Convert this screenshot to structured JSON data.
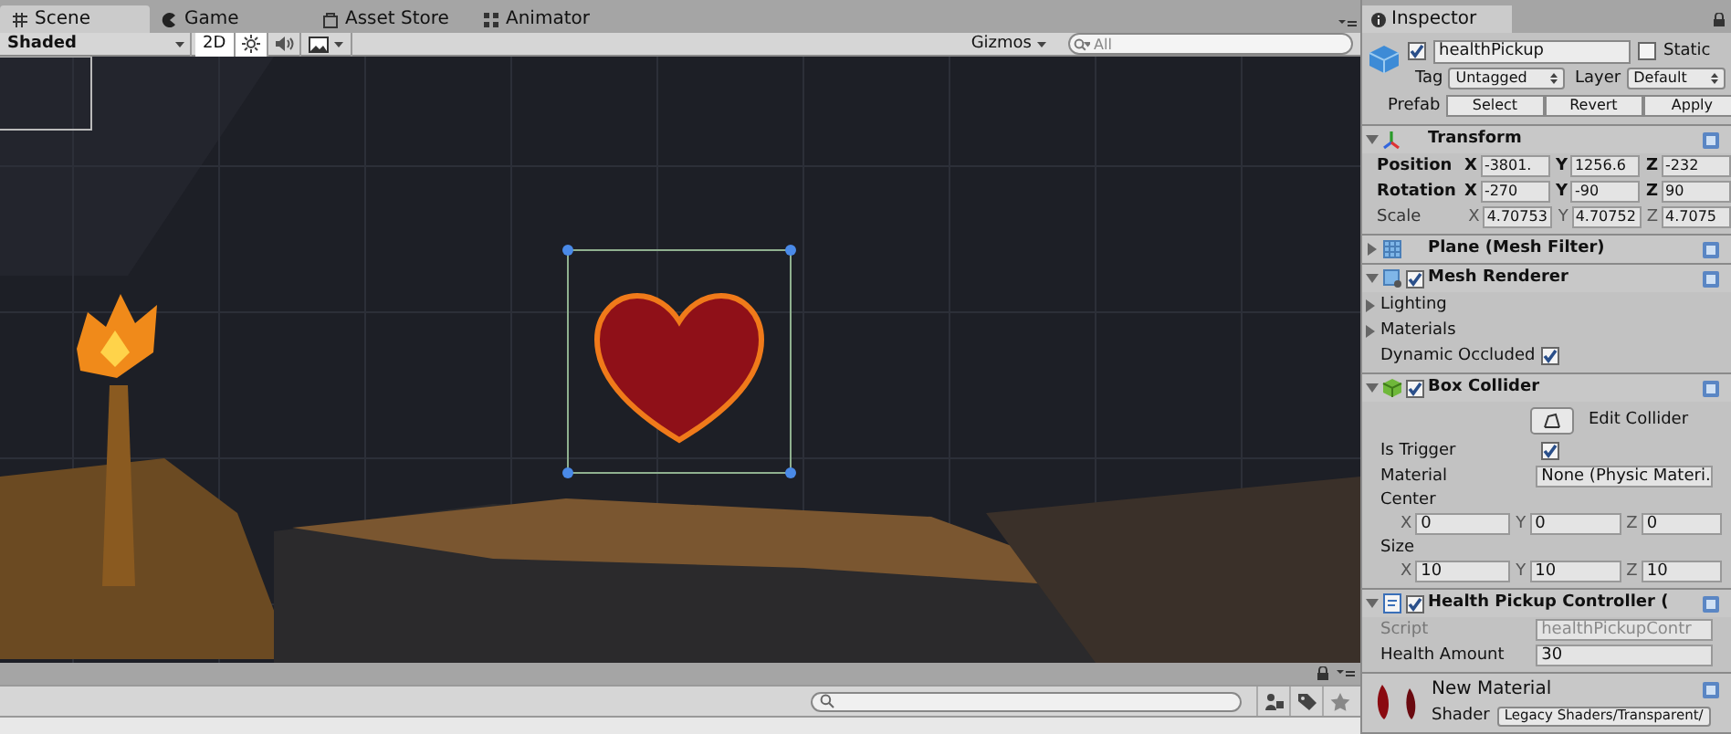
{
  "scene_tabs": [
    {
      "label": "Scene",
      "selected": true
    },
    {
      "label": "Game",
      "selected": false
    },
    {
      "label": "Asset Store",
      "selected": false
    },
    {
      "label": "Animator",
      "selected": false
    }
  ],
  "scene_toolbar": {
    "shading": "Shaded",
    "mode_2d": {
      "label": "2D",
      "selected": true
    },
    "gizmos": "Gizmos",
    "search": {
      "placeholder": "All"
    }
  },
  "inspector": {
    "title": "Inspector",
    "object": {
      "active": true,
      "name": "healthPickup",
      "static_label": "Static",
      "static": false,
      "tag_label": "Tag",
      "tag": "Untagged",
      "layer_label": "Layer",
      "layer": "Default",
      "prefab_label": "Prefab",
      "prefab_buttons": [
        "Select",
        "Revert",
        "Apply"
      ]
    },
    "components": [
      {
        "kind": "transform",
        "title": "Transform",
        "expanded": true,
        "rows": [
          {
            "kind": "vector",
            "label": "Position",
            "overridden": true,
            "fields": [
              {
                "axis": "X",
                "value": "-3801."
              },
              {
                "axis": "Y",
                "value": "1256.6"
              },
              {
                "axis": "Z",
                "value": "-232"
              }
            ]
          },
          {
            "kind": "vector",
            "label": "Rotation",
            "overridden": true,
            "fields": [
              {
                "axis": "X",
                "value": "-270"
              },
              {
                "axis": "Y",
                "value": "-90"
              },
              {
                "axis": "Z",
                "value": "90"
              }
            ]
          },
          {
            "kind": "vector",
            "label": "Scale",
            "overridden": false,
            "fields": [
              {
                "axis": "X",
                "value": "4.70753"
              },
              {
                "axis": "Y",
                "value": "4.70752"
              },
              {
                "axis": "Z",
                "value": "4.7075"
              }
            ]
          }
        ]
      },
      {
        "kind": "mesh_filter",
        "title": "Plane (Mesh Filter)",
        "expanded": false
      },
      {
        "kind": "mesh_renderer",
        "title": "Mesh Renderer",
        "enabled": true,
        "expanded": true,
        "rows": [
          {
            "kind": "foldout",
            "label": "Lighting",
            "expanded": false
          },
          {
            "kind": "foldout",
            "label": "Materials",
            "expanded": false
          },
          {
            "kind": "toggle",
            "label": "Dynamic Occluded",
            "checked": true
          }
        ]
      },
      {
        "kind": "box_collider",
        "title": "Box Collider",
        "enabled": true,
        "expanded": true,
        "rows": [
          {
            "kind": "button",
            "label": "Edit Collider"
          },
          {
            "kind": "toggle",
            "label": "Is Trigger",
            "checked": true
          },
          {
            "kind": "field",
            "label": "Material",
            "value": "None (Physic Materi.",
            "disabled": false
          },
          {
            "kind": "vector_block",
            "label": "Center",
            "fields": [
              {
                "axis": "X",
                "value": "0"
              },
              {
                "axis": "Y",
                "value": "0"
              },
              {
                "axis": "Z",
                "value": "0"
              }
            ]
          },
          {
            "kind": "vector_block",
            "label": "Size",
            "fields": [
              {
                "axis": "X",
                "value": "10"
              },
              {
                "axis": "Y",
                "value": "10"
              },
              {
                "axis": "Z",
                "value": "10"
              }
            ]
          }
        ]
      },
      {
        "kind": "script",
        "title": "Health Pickup Controller (",
        "enabled": true,
        "expanded": true,
        "rows": [
          {
            "kind": "field",
            "label": "Script",
            "value": "healthPickupContr",
            "disabled": true
          },
          {
            "kind": "field",
            "label": "Health Amount",
            "value": "30",
            "disabled": false
          }
        ]
      },
      {
        "kind": "material",
        "title": "New Material",
        "shader_label": "Shader",
        "shader": "Legacy Shaders/Transparent/"
      }
    ]
  }
}
